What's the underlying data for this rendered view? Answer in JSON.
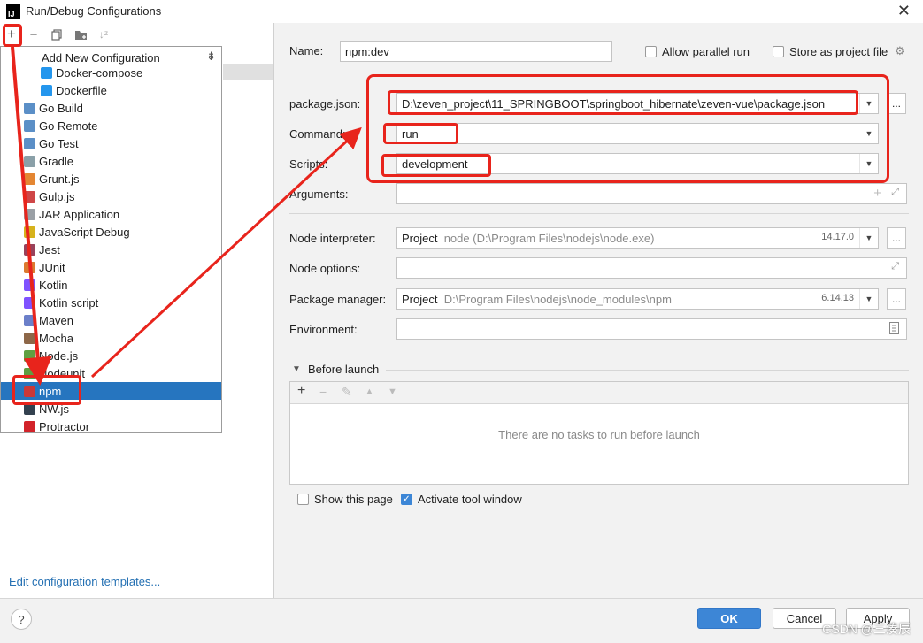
{
  "window": {
    "title": "Run/Debug Configurations",
    "logo_text": "IJ",
    "close_glyph": "✕"
  },
  "left": {
    "toolbar": {
      "add": "+",
      "remove": "−"
    },
    "popup": {
      "title": "Add New Configuration",
      "items": [
        {
          "label": "Docker-compose",
          "icon": "docker-compose-icon",
          "color": "#2496ed"
        },
        {
          "label": "Dockerfile",
          "icon": "dockerfile-icon",
          "color": "#2496ed"
        },
        {
          "label": "Go Build",
          "icon": "go-build-icon",
          "color": "#5b8fc7"
        },
        {
          "label": "Go Remote",
          "icon": "go-remote-icon",
          "color": "#5b8fc7"
        },
        {
          "label": "Go Test",
          "icon": "go-test-icon",
          "color": "#5b8fc7"
        },
        {
          "label": "Gradle",
          "icon": "gradle-icon",
          "color": "#8aa0a8"
        },
        {
          "label": "Grunt.js",
          "icon": "grunt-icon",
          "color": "#e48632"
        },
        {
          "label": "Gulp.js",
          "icon": "gulp-icon",
          "color": "#cf4647"
        },
        {
          "label": "JAR Application",
          "icon": "jar-icon",
          "color": "#9aa0a6"
        },
        {
          "label": "JavaScript Debug",
          "icon": "javascript-debug-icon",
          "color": "#d6b21c"
        },
        {
          "label": "Jest",
          "icon": "jest-icon",
          "color": "#99425b"
        },
        {
          "label": "JUnit",
          "icon": "junit-icon",
          "color": "#dc7a30"
        },
        {
          "label": "Kotlin",
          "icon": "kotlin-icon",
          "color": "#7f52ff"
        },
        {
          "label": "Kotlin script",
          "icon": "kotlin-script-icon",
          "color": "#7f52ff"
        },
        {
          "label": "Maven",
          "icon": "maven-icon",
          "color": "#6b7fc9"
        },
        {
          "label": "Mocha",
          "icon": "mocha-icon",
          "color": "#8d6748"
        },
        {
          "label": "Node.js",
          "icon": "nodejs-icon",
          "color": "#5f9f41"
        },
        {
          "label": "Nodeunit",
          "icon": "nodeunit-icon",
          "color": "#5f9f41"
        },
        {
          "label": "npm",
          "icon": "npm-icon",
          "color": "#cb3837"
        },
        {
          "label": "NW.js",
          "icon": "nwjs-icon",
          "color": "#33414f"
        },
        {
          "label": "Protractor",
          "icon": "protractor-icon",
          "color": "#d2232a"
        }
      ],
      "selected_index": 18
    },
    "edit_templates": "Edit configuration templates..."
  },
  "form": {
    "name_label": "Name:",
    "name_value": "npm:dev",
    "allow_parallel": "Allow parallel run",
    "store_as_project": "Store as project file",
    "package_json_label": "package.json:",
    "package_json_value": "D:\\zeven_project\\11_SPRINGBOOT\\springboot_hibernate\\zeven-vue\\package.json",
    "command_label": "Command:",
    "command_value": "run",
    "scripts_label": "Scripts:",
    "scripts_value": "development",
    "arguments_label": "Arguments:",
    "node_interpreter_label": "Node interpreter:",
    "node_interpreter_prefix": "Project",
    "node_interpreter_path": "node (D:\\Program Files\\nodejs\\node.exe)",
    "node_interpreter_version": "14.17.0",
    "node_options_label": "Node options:",
    "package_manager_label": "Package manager:",
    "package_manager_prefix": "Project",
    "package_manager_path": "D:\\Program Files\\nodejs\\node_modules\\npm",
    "package_manager_version": "6.14.13",
    "environment_label": "Environment:",
    "dots": "..."
  },
  "before_launch": {
    "title": "Before launch",
    "empty_text": "There are no tasks to run before launch"
  },
  "bottom": {
    "show_this_page": "Show this page",
    "activate_tool_window": "Activate tool window",
    "ok": "OK",
    "cancel": "Cancel",
    "apply": "Apply",
    "help": "?",
    "watermark": "CSDN @三湊辰"
  },
  "colors": {
    "accent": "#3d86d6",
    "selection": "#2675bf",
    "annotation": "#e8241c"
  }
}
